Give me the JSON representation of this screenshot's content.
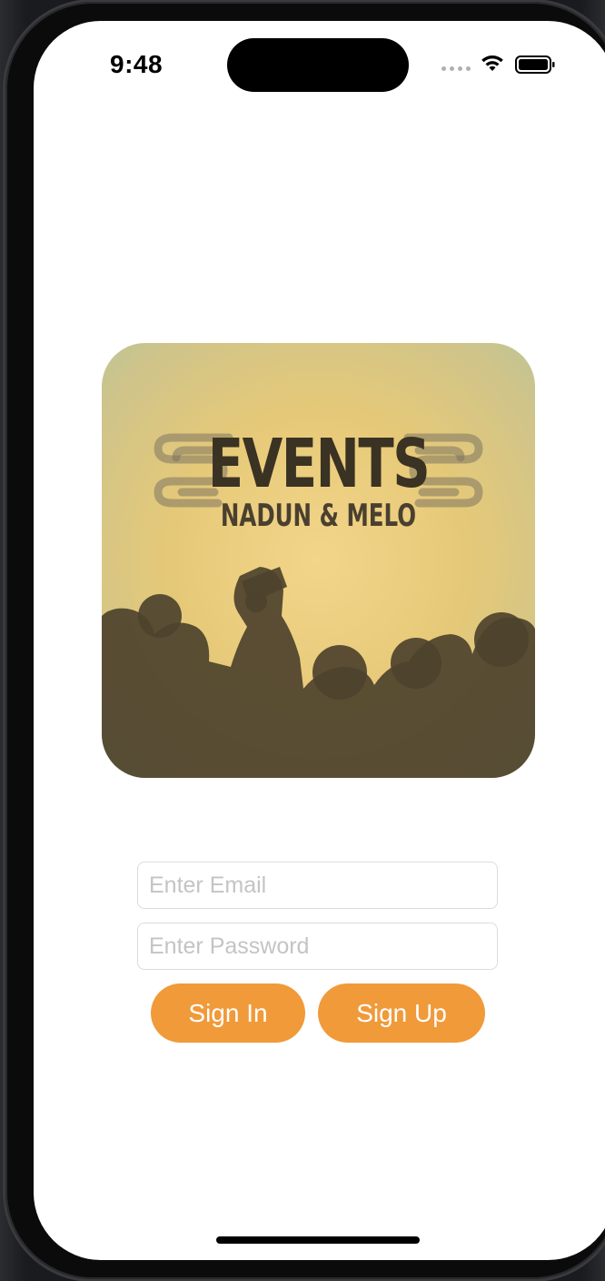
{
  "status_bar": {
    "time": "9:48",
    "icons": [
      "cellular-signal-icon",
      "wifi-icon",
      "battery-icon"
    ]
  },
  "logo": {
    "title": "EVENTS",
    "subtitle": "NADUN & MELO"
  },
  "form": {
    "email_placeholder": "Enter Email",
    "email_value": "",
    "password_placeholder": "Enter Password",
    "password_value": ""
  },
  "actions": {
    "sign_in_label": "Sign In",
    "sign_up_label": "Sign Up"
  },
  "colors": {
    "accent": "#f09a3a",
    "background": "#ffffff"
  }
}
